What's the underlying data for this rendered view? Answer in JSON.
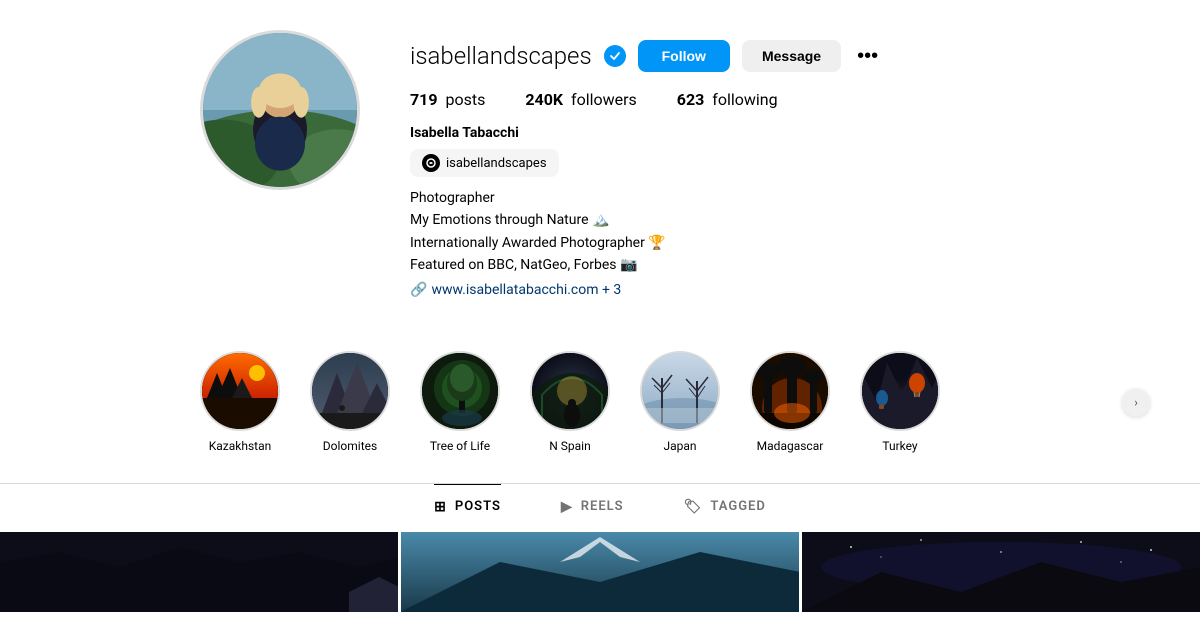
{
  "header": {
    "username": "isabellandscapes",
    "verified": true,
    "follow_label": "Follow",
    "message_label": "Message",
    "more_label": "•••"
  },
  "stats": {
    "posts_count": "719",
    "posts_label": "posts",
    "followers_count": "240K",
    "followers_label": "followers",
    "following_count": "623",
    "following_label": "following"
  },
  "profile": {
    "display_name": "Isabella Tabacchi",
    "threads_handle": "isabellandscapes",
    "bio_line1": "Photographer",
    "bio_line2": "My Emotions through Nature 🏔️",
    "bio_line3": "Internationally Awarded Photographer 🏆",
    "bio_line4": "Featured on BBC, NatGeo, Forbes 📷",
    "link_text": "www.isabellatabacchi.com + 3",
    "link_icon": "🔗"
  },
  "highlights": [
    {
      "id": "kazakhstan",
      "label": "Kazakhstan"
    },
    {
      "id": "dolomites",
      "label": "Dolomites"
    },
    {
      "id": "treeoflife",
      "label": "Tree of Life"
    },
    {
      "id": "nspain",
      "label": "N Spain"
    },
    {
      "id": "japan",
      "label": "Japan"
    },
    {
      "id": "madagascar",
      "label": "Madagascar"
    },
    {
      "id": "turkey",
      "label": "Turkey"
    }
  ],
  "tabs": [
    {
      "id": "posts",
      "icon": "⊞",
      "label": "POSTS",
      "active": true
    },
    {
      "id": "reels",
      "icon": "▶",
      "label": "REELS",
      "active": false
    },
    {
      "id": "tagged",
      "icon": "🏷",
      "label": "TAGGED",
      "active": false
    }
  ],
  "colors": {
    "follow_btn": "#0095f6",
    "message_btn": "#efefef",
    "verified": "#0095f6"
  }
}
